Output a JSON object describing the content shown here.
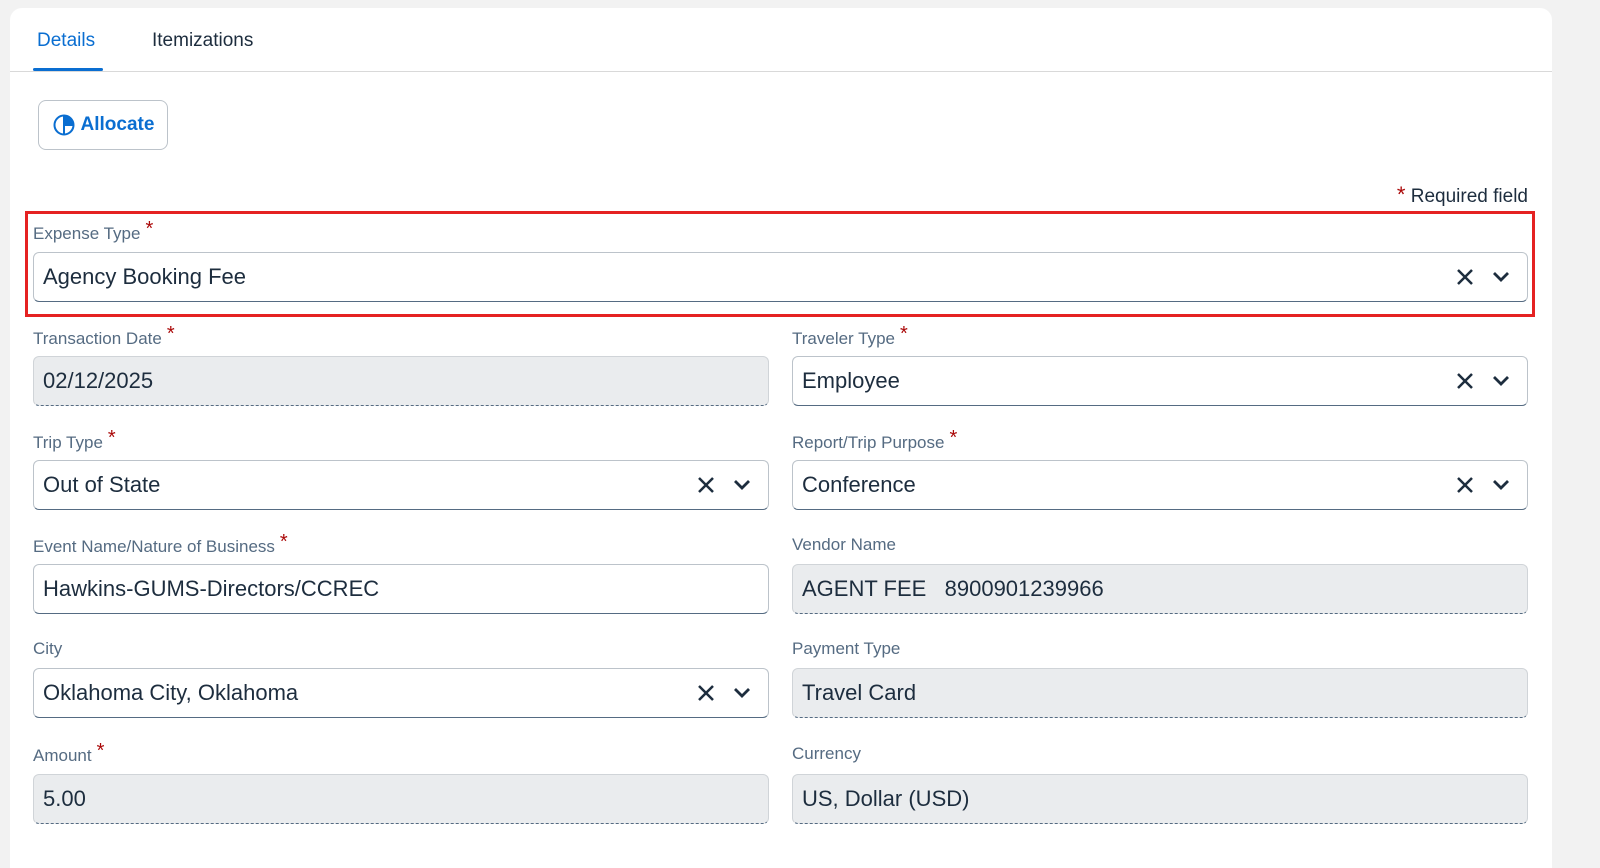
{
  "tabs": [
    {
      "label": "Details",
      "active": true
    },
    {
      "label": "Itemizations",
      "active": false
    }
  ],
  "allocate_button": {
    "label": "Allocate",
    "icon": "pie-chart-icon"
  },
  "required_note": {
    "star": "*",
    "text": "Required field"
  },
  "required_star": "*",
  "accent_color": "#0a6ed1",
  "highlight_color": "#e52222",
  "fields": {
    "expense_type": {
      "label": "Expense Type",
      "required": true,
      "value": "Agency Booking Fee",
      "control": "combobox"
    },
    "transaction_date": {
      "label": "Transaction Date",
      "required": true,
      "value": "02/12/2025",
      "control": "readonly"
    },
    "traveler_type": {
      "label": "Traveler Type",
      "required": true,
      "value": "Employee",
      "control": "combobox"
    },
    "trip_type": {
      "label": "Trip Type",
      "required": true,
      "value": "Out of State",
      "control": "combobox"
    },
    "report_purpose": {
      "label": "Report/Trip Purpose",
      "required": true,
      "value": "Conference",
      "control": "combobox"
    },
    "event_name": {
      "label": "Event Name/Nature of Business",
      "required": true,
      "value": "Hawkins-GUMS-Directors/CCREC",
      "control": "text"
    },
    "vendor_name": {
      "label": "Vendor Name",
      "required": false,
      "value": "AGENT FEE   8900901239966",
      "control": "readonly"
    },
    "city": {
      "label": "City",
      "required": false,
      "value": "Oklahoma City, Oklahoma",
      "control": "combobox"
    },
    "payment_type": {
      "label": "Payment Type",
      "required": false,
      "value": "Travel Card",
      "control": "readonly"
    },
    "amount": {
      "label": "Amount",
      "required": true,
      "value": "5.00",
      "control": "readonly"
    },
    "currency": {
      "label": "Currency",
      "required": false,
      "value": "US, Dollar (USD)",
      "control": "readonly"
    }
  }
}
